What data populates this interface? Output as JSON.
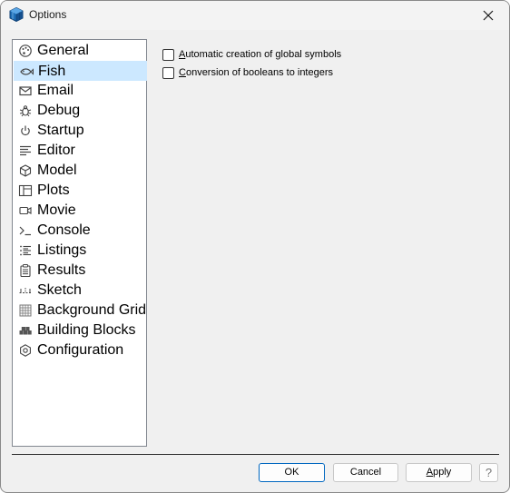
{
  "window": {
    "title": "Options",
    "icon": "cube-app-icon",
    "close_icon": "close-icon"
  },
  "sidebar": {
    "items": [
      {
        "label": "General",
        "icon": "palette-icon",
        "selected": false
      },
      {
        "label": "Fish",
        "icon": "fish-icon",
        "selected": true
      },
      {
        "label": "Email",
        "icon": "envelope-icon",
        "selected": false
      },
      {
        "label": "Debug",
        "icon": "bug-icon",
        "selected": false
      },
      {
        "label": "Startup",
        "icon": "power-icon",
        "selected": false
      },
      {
        "label": "Editor",
        "icon": "text-lines-icon",
        "selected": false
      },
      {
        "label": "Model",
        "icon": "cube-icon",
        "selected": false
      },
      {
        "label": "Plots",
        "icon": "panel-layout-icon",
        "selected": false
      },
      {
        "label": "Movie",
        "icon": "video-camera-icon",
        "selected": false
      },
      {
        "label": "Console",
        "icon": "terminal-prompt-icon",
        "selected": false
      },
      {
        "label": "Listings",
        "icon": "bulleted-list-icon",
        "selected": false
      },
      {
        "label": "Results",
        "icon": "clipboard-icon",
        "selected": false
      },
      {
        "label": "Sketch",
        "icon": "dashed-sketch-icon",
        "selected": false
      },
      {
        "label": "Background Grid",
        "icon": "grid-icon",
        "selected": false
      },
      {
        "label": "Building Blocks",
        "icon": "blocks-icon",
        "selected": false
      },
      {
        "label": "Configuration",
        "icon": "settings-gear-icon",
        "selected": false
      }
    ]
  },
  "fish_options": [
    {
      "mnemonic": "A",
      "rest": "utomatic creation of global symbols",
      "checked": false
    },
    {
      "mnemonic": "C",
      "rest": "onversion of booleans to integers",
      "checked": false
    }
  ],
  "buttons": {
    "ok": {
      "mnemonic": "",
      "label": "OK"
    },
    "cancel": {
      "mnemonic": "",
      "label": "Cancel"
    },
    "apply_mnemonic": "A",
    "apply_rest": "pply",
    "help": "?"
  },
  "colors": {
    "selection_bg": "#cce8ff",
    "default_button_border": "#0067c0",
    "window_bg": "#f0f0f0"
  }
}
